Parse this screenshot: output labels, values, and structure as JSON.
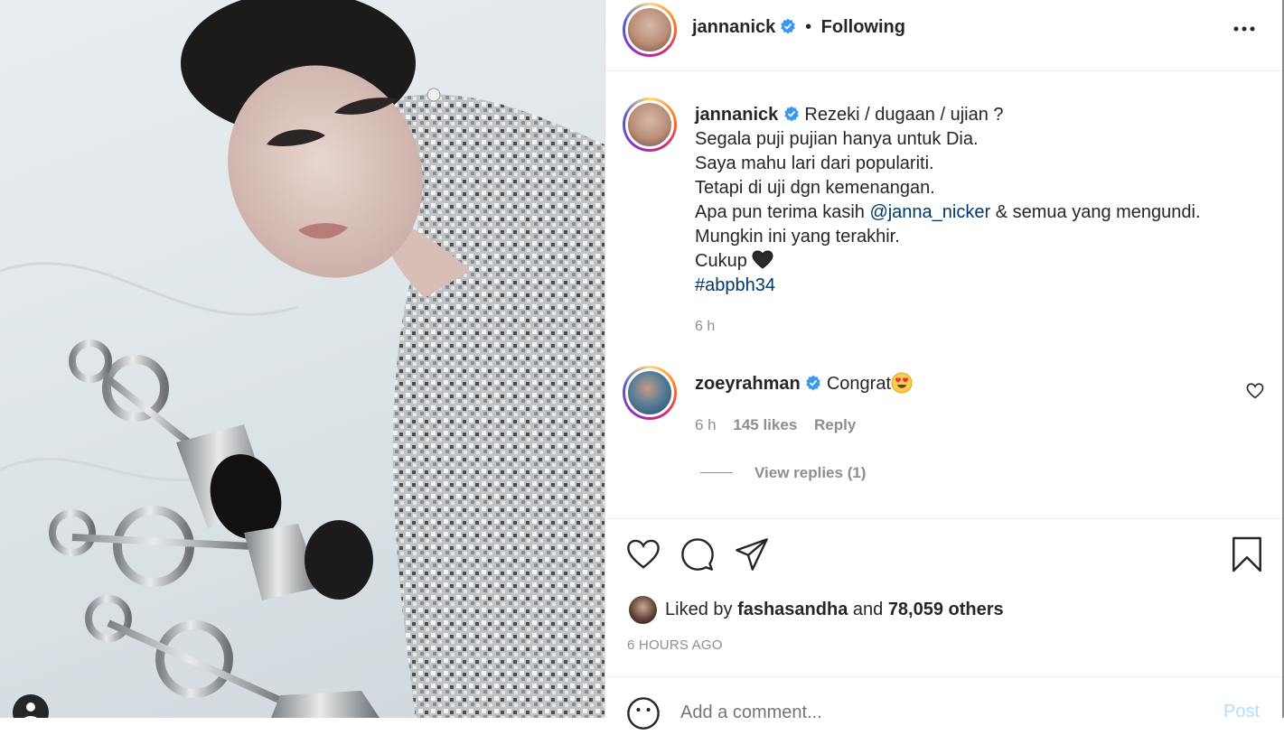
{
  "post_author": {
    "username": "jannanick",
    "follow_separator": "•",
    "follow_status": "Following"
  },
  "caption": {
    "username": "jannanick",
    "lines": [
      "Rezeki / dugaan / ujian ?",
      "Segala puji pujian hanya untuk Dia.",
      "Saya mahu lari dari populariti.",
      "Tetapi di uji dgn kemenangan."
    ],
    "line5_prefix": "Apa pun terima kasih ",
    "mention": "@janna_nicker",
    "line5_suffix": " & semua yang mengundi.",
    "line6": "Mungkin ini yang terakhir.",
    "line7": "Cukup",
    "hashtag": "#abpbh34",
    "time": "6 h"
  },
  "comment": {
    "username": "zoeyrahman",
    "text": "Congrat",
    "time": "6 h",
    "likes": "145 likes",
    "reply_label": "Reply",
    "view_replies": "View replies (1)"
  },
  "likes": {
    "prefix": "Liked by ",
    "user": "fashasandha",
    "mid": " and ",
    "others": "78,059 others",
    "timestamp": "6 HOURS AGO"
  },
  "comment_box": {
    "placeholder": "Add a comment...",
    "post_label": "Post"
  },
  "icons": {
    "more": "more-options-icon",
    "heart": "heart-icon",
    "comment": "comment-icon",
    "share": "share-icon",
    "save": "bookmark-icon",
    "emoji": "emoji-icon"
  },
  "colors": {
    "verified": "#3897f0",
    "link": "#00376b",
    "post_disabled": "#b2dffc"
  }
}
